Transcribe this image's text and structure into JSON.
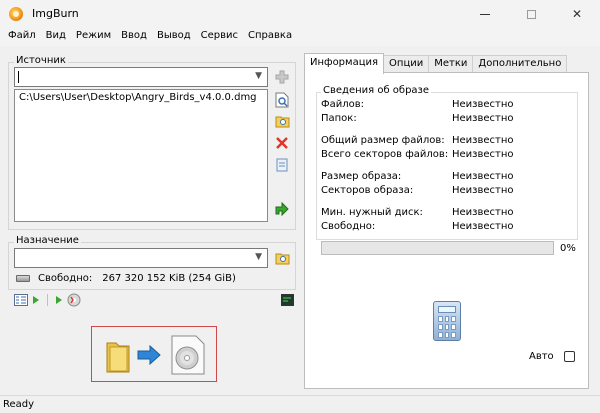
{
  "window": {
    "title": "ImgBurn",
    "controls": {
      "min": "—",
      "max": "☐",
      "close": "✕"
    }
  },
  "menu": [
    "Файл",
    "Вид",
    "Режим",
    "Ввод",
    "Вывод",
    "Сервис",
    "Справка"
  ],
  "source": {
    "label": "Источник",
    "combo_value": "",
    "files": [
      "C:\\Users\\User\\Desktop\\Angry_Birds_v4.0.0.dmg"
    ]
  },
  "destination": {
    "label": "Назначение",
    "combo_value": "",
    "free_label": "Свободно:",
    "free_value": "267 320 152 KiB  (254 GiB)"
  },
  "tabs": [
    "Информация",
    "Опции",
    "Метки",
    "Дополнительно"
  ],
  "info": {
    "group_title": "Сведения об образе",
    "rows": [
      {
        "label": "Файлов:",
        "value": "Неизвестно"
      },
      {
        "label": "Папок:",
        "value": "Неизвестно"
      },
      {
        "label": "Общий размер файлов:",
        "value": "Неизвестно"
      },
      {
        "label": "Всего секторов файлов:",
        "value": "Неизвестно"
      },
      {
        "label": "Размер образа:",
        "value": "Неизвестно"
      },
      {
        "label": "Секторов образа:",
        "value": "Неизвестно"
      },
      {
        "label": "Мин. нужный диск:",
        "value": "Неизвестно"
      },
      {
        "label": "Свободно:",
        "value": "Неизвестно"
      }
    ],
    "progress_percent": 0,
    "progress_text": "0%",
    "auto_label": "Авто",
    "auto_checked": false
  },
  "status": {
    "text": "Ready"
  },
  "colors": {
    "highlight_border": "#d04848",
    "progress_fill": "#06b025"
  }
}
